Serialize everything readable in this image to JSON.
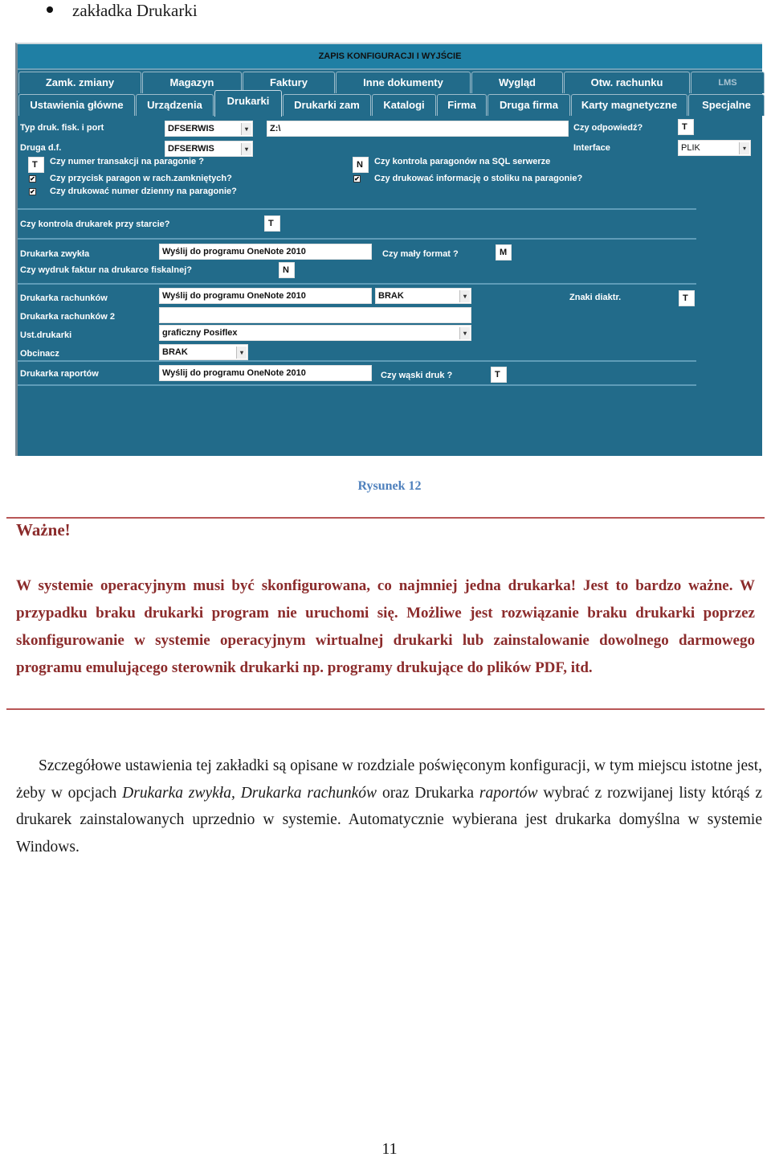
{
  "document": {
    "bullet": "zakładka Drukarki",
    "caption": "Rysunek 12",
    "important_title": "Ważne!",
    "important_text": "W systemie operacyjnym musi być skonfigurowana, co najmniej jedna drukarka! Jest to bardzo ważne. W przypadku braku drukarki program nie uruchomi się. Możliwe jest rozwiązanie braku drukarki poprzez skonfigurowanie w systemie operacyjnym wirtualnej drukarki lub zainstalowanie dowolnego darmowego programu emulującego sterownik drukarki np. programy drukujące do plików PDF, itd.",
    "body": {
      "p1": "Szczegółowe ustawienia tej zakładki są opisane w rozdziale poświęconym konfiguracji, w tym miejscu istotne jest, żeby w opcjach ",
      "em1": "Drukarka zwykła, Drukarka rachunków",
      "p2": " oraz Drukarka ",
      "em2": "raportów",
      "p3": " wybrać z rozwijanej listy którąś z drukarek zainstalowanych uprzednio w systemie. Automatycznie wybierana jest drukarka domyślna w systemie Windows."
    },
    "page_number": "11"
  },
  "app": {
    "title": "ZAPIS KONFIGURACJI I WYJŚCIE",
    "tabs_row1": [
      "Zamk. zmiany",
      "Magazyn",
      "Faktury",
      "Inne dokumenty",
      "Wygląd",
      "Otw. rachunku",
      "LMS"
    ],
    "tabs_row2": [
      "Ustawienia główne",
      "Urządzenia",
      "Drukarki",
      "Drukarki zam",
      "Katalogi",
      "Firma",
      "Druga firma",
      "Karty magnetyczne",
      "Specjalne"
    ],
    "active_tab": "Drukarki",
    "form": {
      "typ_druk_label": "Typ druk. fisk. i port",
      "typ_druk_value": "DFSERWIS",
      "port_value": "Z:\\",
      "czy_odpowiedz_label": "Czy odpowiedź?",
      "czy_odpowiedz_value": "T",
      "druga_df_label": "Druga d.f.",
      "druga_df_value": "DFSERWIS",
      "interface_label": "Interface",
      "interface_value": "PLIK",
      "nr_transakcji_value": "T",
      "nr_transakcji_label": "Czy numer transakcji na paragonie ?",
      "przycisk_paragon_label": "Czy przycisk paragon w rach.zamkniętych?",
      "numer_dzienny_label": "Czy drukować numer dzienny na paragonie?",
      "kontrola_sql_value": "N",
      "kontrola_sql_label": "Czy kontrola paragonów na SQL serwerze",
      "info_stolik_label": "Czy drukować informację o stoliku na paragonie?",
      "kontrola_start_label": "Czy kontrola drukarek przy starcie?",
      "kontrola_start_value": "T",
      "drukarka_zwykla_label": "Drukarka zwykła",
      "drukarka_zwykla_value": "Wyślij do programu OneNote 2010",
      "maly_format_label": "Czy mały format ?",
      "maly_format_value": "M",
      "faktury_fiskalna_label": "Czy wydruk faktur na drukarce fiskalnej?",
      "faktury_fiskalna_value": "N",
      "drukarka_rachunkow_label": "Drukarka rachunków",
      "drukarka_rachunkow_value": "Wyślij do programu OneNote 2010",
      "drukarka_rachunkow_select": "BRAK",
      "znaki_diaktr_label": "Znaki diaktr.",
      "znaki_diaktr_value": "T",
      "drukarka_rachunkow2_label": "Drukarka rachunków 2",
      "drukarka_rachunkow2_value": "",
      "ust_drukarki_label": "Ust.drukarki",
      "ust_drukarki_value": "graficzny Posiflex",
      "obcinacz_label": "Obcinacz",
      "obcinacz_value": "BRAK",
      "drukarka_raportow_label": "Drukarka raportów",
      "drukarka_raportow_value": "Wyślij do programu OneNote 2010",
      "waski_druk_label": "Czy wąski druk ?",
      "waski_druk_value": "T",
      "checkbox_mark": "✔",
      "dropdown_arrow": "▾"
    }
  }
}
